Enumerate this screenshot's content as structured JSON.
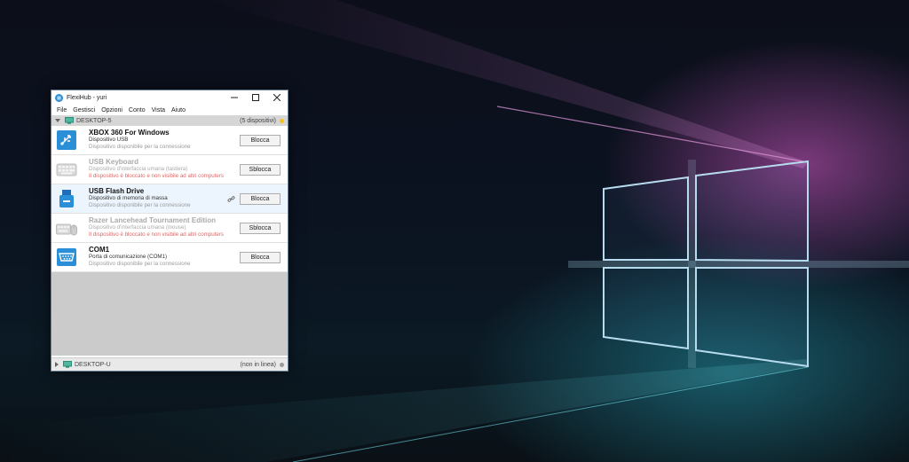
{
  "window": {
    "title": "FlexiHub - yuri",
    "menu": [
      "File",
      "Gestisci",
      "Opzioni",
      "Conto",
      "Vista",
      "Aiuto"
    ]
  },
  "groups": [
    {
      "name": "DESKTOP-5",
      "count_label": "(5 dispositivi)",
      "status_color": "#f3c21a"
    },
    {
      "name": "DESKTOP-U",
      "count_label": "(non in linea)",
      "status_color": "#9a9a9a"
    }
  ],
  "devices": [
    {
      "name": "XBOX 360 For Windows",
      "desc": "Dispositivo USB",
      "status": "Dispositivo disponibile per la connessione",
      "button": "Blocca",
      "icon": "usb-icon"
    },
    {
      "name": "USB Keyboard",
      "desc": "Dispositivo d'interfaccia umana (tastiera)",
      "status": "Il dispositivo è bloccato e non visibile ad altri computers",
      "button": "Sblocca",
      "icon": "keyboard-icon"
    },
    {
      "name": "USB Flash Drive",
      "desc": "Dispositivo di memoria di massa",
      "status": "Dispositivo disponibile per la connessione",
      "button": "Blocca",
      "icon": "flash-drive-icon"
    },
    {
      "name": "Razer Lancehead Tournament Edition",
      "desc": "Dispositivo d'interfaccia umana (mouse)",
      "status": "Il dispositivo è bloccato e non visibile ad altri computers",
      "button": "Sblocca",
      "icon": "keyboard-mouse-icon"
    },
    {
      "name": "COM1",
      "desc": "Porta di comunicazione (COM1)",
      "status": "Dispositivo disponibile per la connessione",
      "button": "Blocca",
      "icon": "serial-port-icon"
    }
  ],
  "colors": {
    "accent": "#2a8fd6",
    "blocked_text": "#e06666",
    "selected_row": "#ecf5fd"
  }
}
